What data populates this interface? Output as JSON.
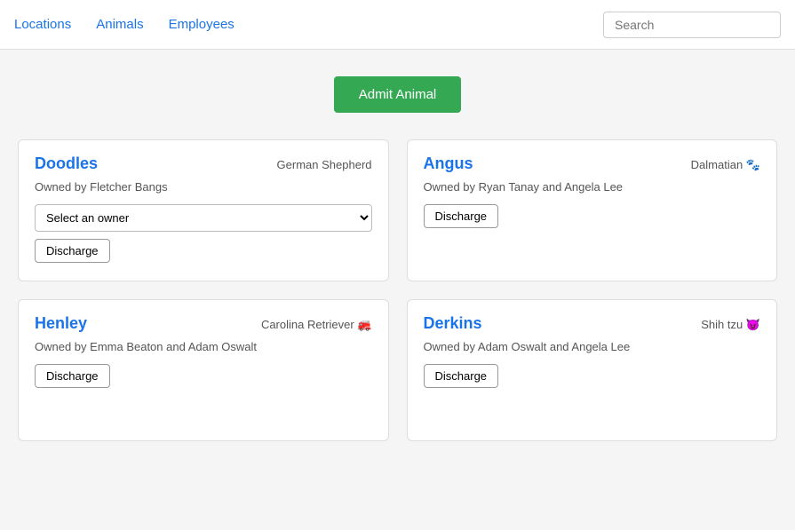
{
  "nav": {
    "links": [
      {
        "label": "Locations",
        "id": "locations"
      },
      {
        "label": "Animals",
        "id": "animals"
      },
      {
        "label": "Employees",
        "id": "employees"
      }
    ],
    "search_placeholder": "Search"
  },
  "admit_button_label": "Admit Animal",
  "animals": [
    {
      "id": "doodles",
      "name": "Doodles",
      "breed": "German Shepherd",
      "breed_emoji": "",
      "owned_by": "Owned by Fletcher Bangs",
      "has_owner_select": true,
      "owner_select_placeholder": "Select an owner",
      "has_discharge": true,
      "discharge_label": "Discharge"
    },
    {
      "id": "angus",
      "name": "Angus",
      "breed": "Dalmatian",
      "breed_emoji": "🐾",
      "owned_by": "Owned by Ryan Tanay and Angela Lee",
      "has_owner_select": false,
      "has_discharge": true,
      "discharge_label": "Discharge"
    },
    {
      "id": "henley",
      "name": "Henley",
      "breed": "Carolina Retriever",
      "breed_emoji": "🚒",
      "owned_by": "Owned by Emma Beaton and Adam Oswalt",
      "has_owner_select": false,
      "has_discharge": true,
      "discharge_label": "Discharge"
    },
    {
      "id": "derkins",
      "name": "Derkins",
      "breed": "Shih tzu",
      "breed_emoji": "😈",
      "owned_by": "Owned by Adam Oswalt and Angela Lee",
      "has_owner_select": false,
      "has_discharge": true,
      "discharge_label": "Discharge"
    }
  ]
}
